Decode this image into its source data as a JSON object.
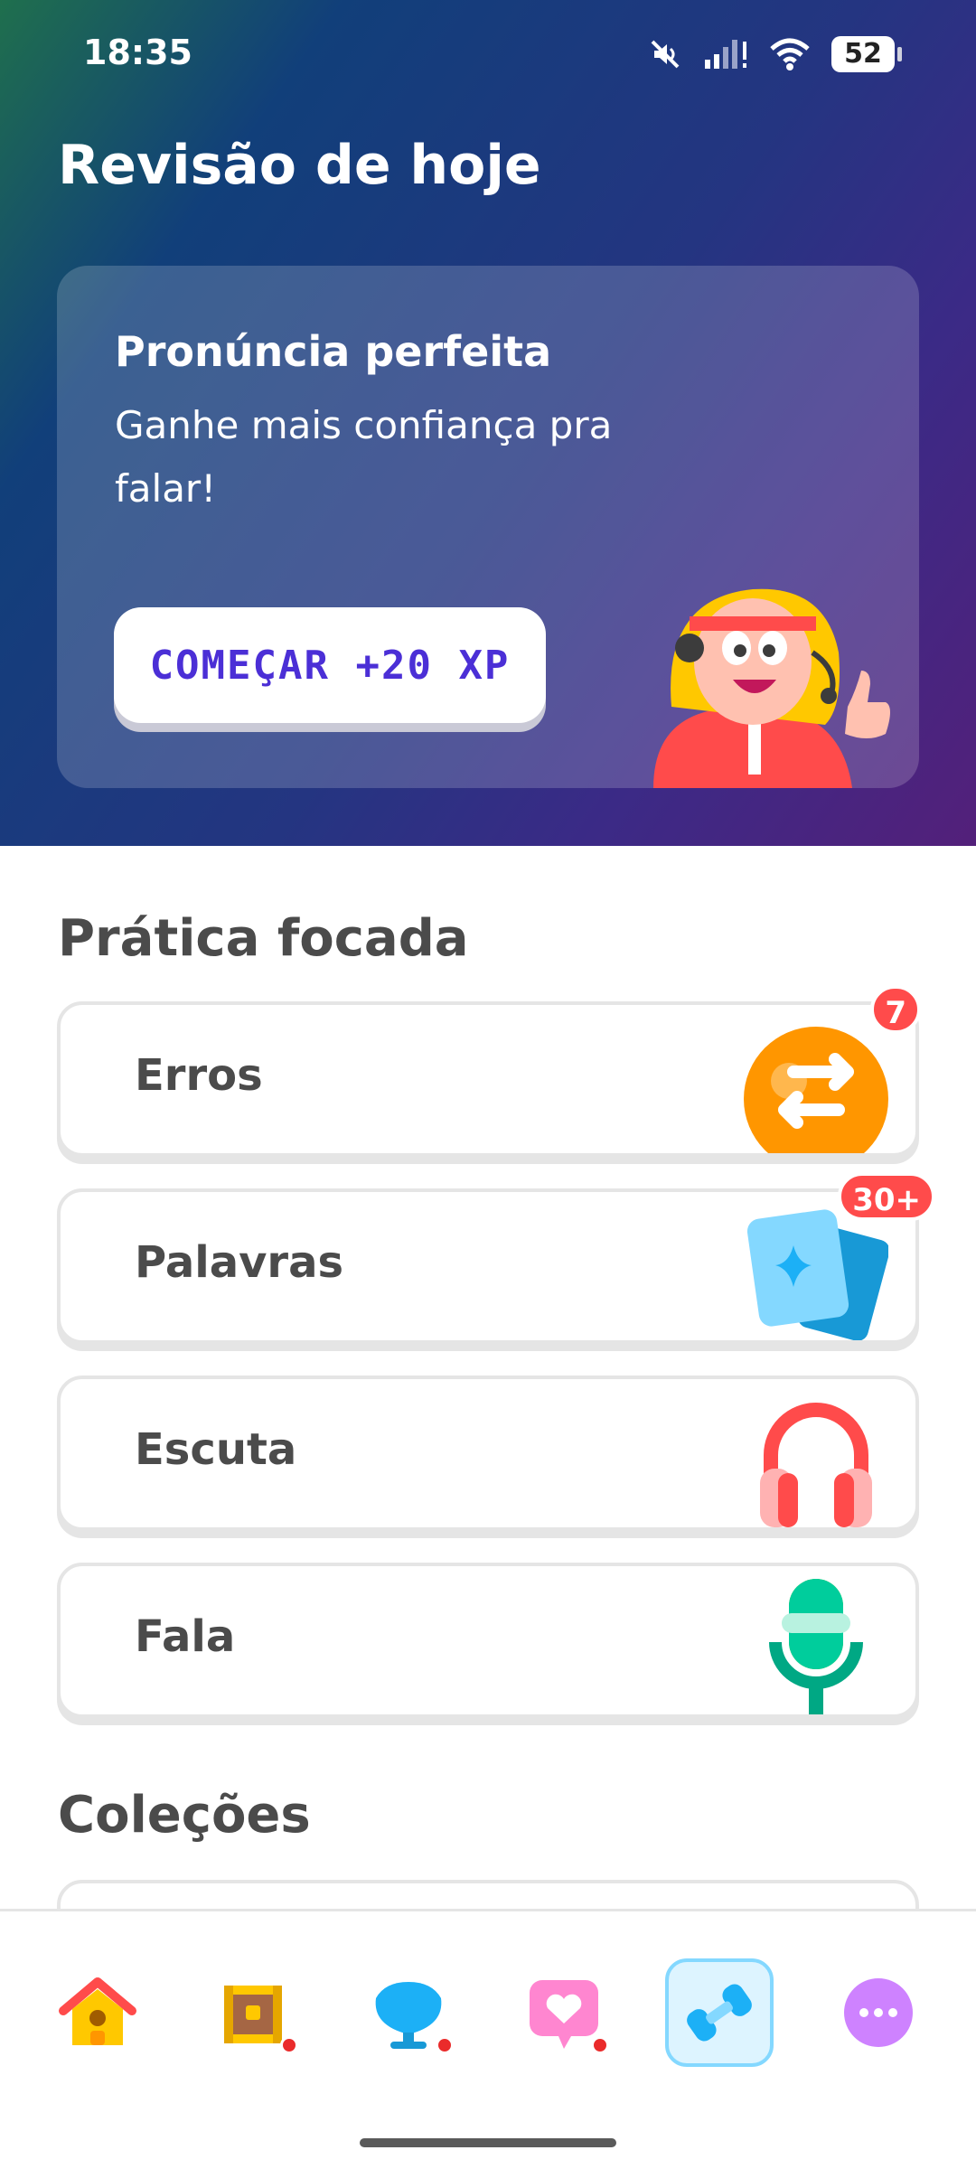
{
  "status_bar": {
    "time": "18:35",
    "battery": "52"
  },
  "header": {
    "title": "Revisão de hoje"
  },
  "review_card": {
    "title": "Pronúncia perfeita",
    "subtitle": "Ganhe mais confiança pra falar!",
    "button_label": "COMEÇAR +20 XP"
  },
  "focused_practice": {
    "title": "Prática focada",
    "items": [
      {
        "label": "Erros",
        "badge": "7",
        "icon": "refresh-icon"
      },
      {
        "label": "Palavras",
        "badge": "30+",
        "icon": "cards-icon"
      },
      {
        "label": "Escuta",
        "badge": "",
        "icon": "headphones-icon"
      },
      {
        "label": "Fala",
        "badge": "",
        "icon": "microphone-icon"
      }
    ]
  },
  "collections": {
    "title": "Coleções"
  },
  "bottom_nav": {
    "items": [
      {
        "icon": "home-icon",
        "active": false,
        "dot": false
      },
      {
        "icon": "treasure-chest-icon",
        "active": false,
        "dot": true
      },
      {
        "icon": "leaderboard-icon",
        "active": false,
        "dot": true
      },
      {
        "icon": "heart-chat-icon",
        "active": false,
        "dot": true
      },
      {
        "icon": "dumbbell-icon",
        "active": true,
        "dot": false
      },
      {
        "icon": "more-icon",
        "active": false,
        "dot": false
      }
    ]
  },
  "colors": {
    "accent": "#4b2fd6",
    "badge": "#ff4b4b",
    "active_tab_bg": "#ddf4ff",
    "active_tab_border": "#84d8ff"
  }
}
